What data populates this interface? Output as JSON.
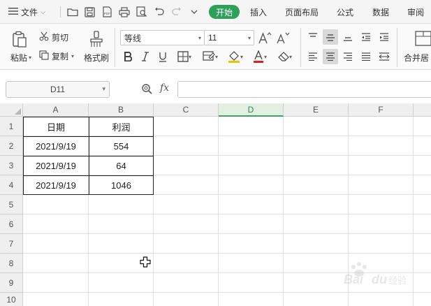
{
  "menubar": {
    "file_label": "文件",
    "tabs": [
      {
        "label": "开始",
        "active": true
      },
      {
        "label": "插入"
      },
      {
        "label": "页面布局"
      },
      {
        "label": "公式"
      },
      {
        "label": "数据"
      },
      {
        "label": "审阅"
      }
    ]
  },
  "ribbon": {
    "paste_label": "粘贴",
    "cut_label": "剪切",
    "copy_label": "复制",
    "format_painter_label": "格式刷",
    "font_name": "等线",
    "font_size": "11",
    "merge_label": "合并居",
    "accent_font_color": "#e02020",
    "accent_fill_color": "#f2c200"
  },
  "formula_bar": {
    "name_box": "D11",
    "fx_label": "fx",
    "formula": ""
  },
  "sheet": {
    "columns": [
      "A",
      "B",
      "C",
      "D",
      "E",
      "F"
    ],
    "selected_column": "D",
    "rows": [
      "1",
      "2",
      "3",
      "4",
      "5",
      "6",
      "7",
      "8",
      "9",
      "10"
    ],
    "table": {
      "headers": [
        "日期",
        "利润"
      ],
      "data": [
        [
          "2021/9/19",
          "554"
        ],
        [
          "2021/9/19",
          "64"
        ],
        [
          "2021/9/19",
          "1046"
        ]
      ]
    }
  },
  "accent_color": "#2ea05a"
}
